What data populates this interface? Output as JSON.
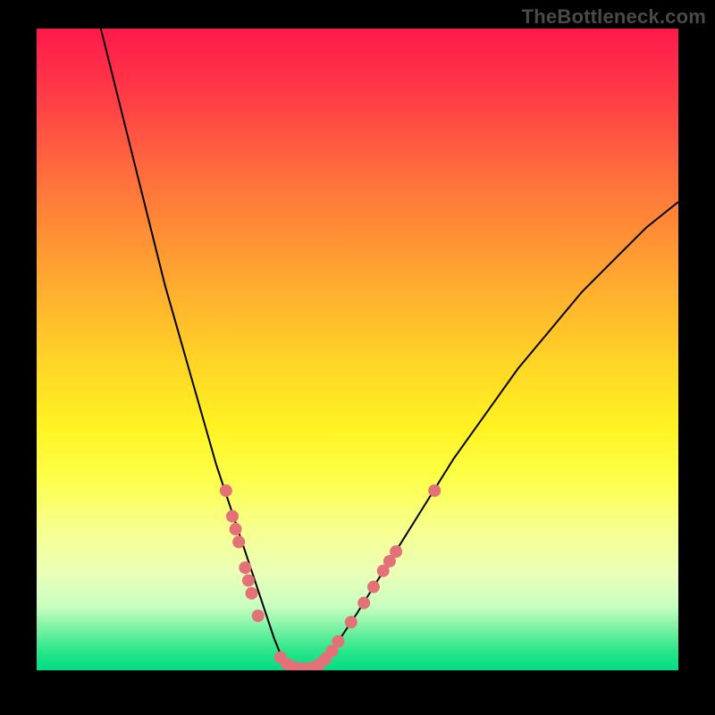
{
  "watermark": "TheBottleneck.com",
  "colors": {
    "frame_bg": "#000000",
    "curve": "#000000",
    "marker_fill": "#e37177",
    "marker_stroke": "#c85860"
  },
  "chart_data": {
    "type": "line",
    "title": "",
    "xlabel": "",
    "ylabel": "",
    "xlim": [
      0,
      100
    ],
    "ylim": [
      0,
      100
    ],
    "grid": false,
    "curve": {
      "x": [
        0,
        3,
        6,
        9,
        12,
        15,
        18,
        20,
        22,
        24,
        26,
        28,
        29,
        30,
        31,
        32,
        33,
        34,
        35,
        36,
        37,
        38,
        39,
        40,
        41,
        42,
        43,
        44,
        45,
        47,
        50,
        55,
        60,
        65,
        70,
        75,
        80,
        85,
        90,
        95,
        100
      ],
      "y": [
        144,
        130,
        117,
        104,
        92,
        80,
        68,
        60,
        53,
        46,
        39,
        32,
        29,
        26,
        23,
        20,
        17,
        14,
        11,
        8,
        5,
        2.5,
        1,
        0.4,
        0.2,
        0.2,
        0.4,
        1,
        2,
        4.5,
        9,
        17,
        25,
        33,
        40,
        47,
        53,
        59,
        64,
        69,
        73
      ]
    },
    "series": [
      {
        "name": "markers",
        "points": [
          {
            "x": 29.5,
            "y": 28
          },
          {
            "x": 30.5,
            "y": 24
          },
          {
            "x": 31.0,
            "y": 22
          },
          {
            "x": 31.5,
            "y": 20
          },
          {
            "x": 32.5,
            "y": 16
          },
          {
            "x": 33.0,
            "y": 14
          },
          {
            "x": 33.5,
            "y": 12
          },
          {
            "x": 34.5,
            "y": 8.5
          },
          {
            "x": 38.0,
            "y": 2.0
          },
          {
            "x": 39.0,
            "y": 1.0
          },
          {
            "x": 40.0,
            "y": 0.5
          },
          {
            "x": 41.0,
            "y": 0.3
          },
          {
            "x": 42.0,
            "y": 0.3
          },
          {
            "x": 43.0,
            "y": 0.4
          },
          {
            "x": 44.0,
            "y": 0.9
          },
          {
            "x": 45.0,
            "y": 1.8
          },
          {
            "x": 46.0,
            "y": 3.0
          },
          {
            "x": 47.0,
            "y": 4.5
          },
          {
            "x": 49.0,
            "y": 7.5
          },
          {
            "x": 51.0,
            "y": 10.5
          },
          {
            "x": 52.5,
            "y": 13.0
          },
          {
            "x": 54.0,
            "y": 15.5
          },
          {
            "x": 55.0,
            "y": 17.0
          },
          {
            "x": 56.0,
            "y": 18.5
          },
          {
            "x": 62.0,
            "y": 28.0
          }
        ]
      }
    ]
  }
}
